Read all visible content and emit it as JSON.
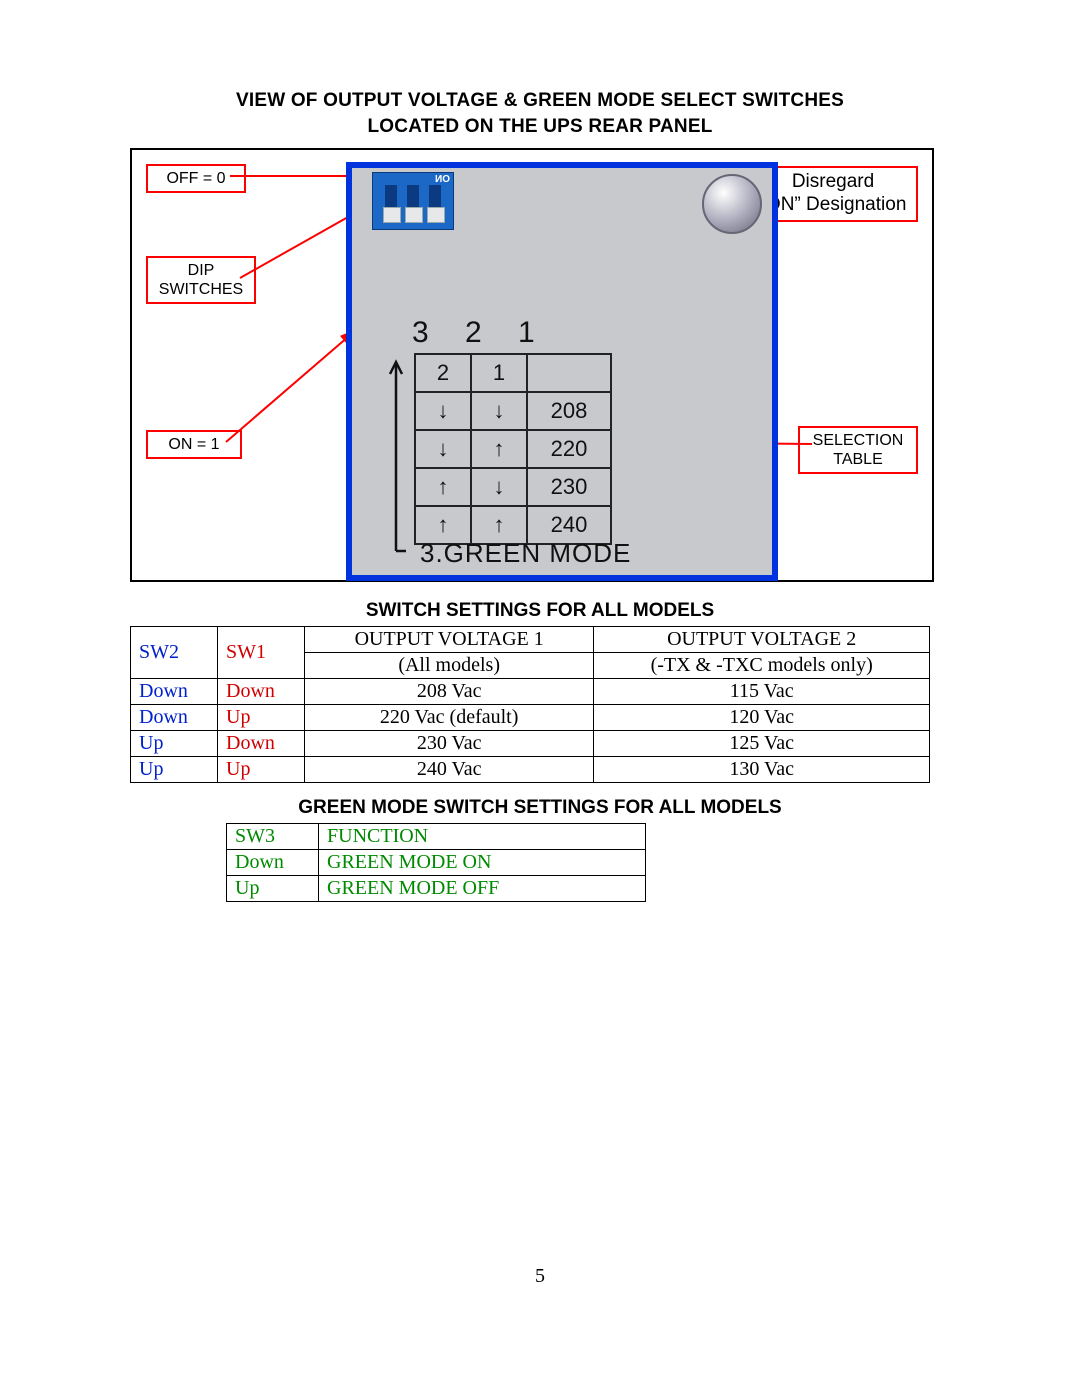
{
  "title_line1": "VIEW OF OUTPUT VOLTAGE & GREEN MODE SELECT SWITCHES",
  "title_line2": "LOCATED ON THE UPS REAR PANEL",
  "page_number": "5",
  "figure": {
    "callouts": {
      "off": "OFF = 0",
      "dip": "DIP\nSWITCHES",
      "on": "ON = 1",
      "disregard_l1": "Disregard",
      "disregard_l2": "“ON” Designation",
      "selection_l1": "SELECTION",
      "selection_l2": "TABLE"
    },
    "panel": {
      "nums": "3  2  1",
      "green_label": "3.GREEN MODE",
      "selection_rows": [
        {
          "c2": "2",
          "c1": "1",
          "val": ""
        },
        {
          "c2": "↓",
          "c1": "↓",
          "val": "208"
        },
        {
          "c2": "↓",
          "c1": "↑",
          "val": "220"
        },
        {
          "c2": "↑",
          "c1": "↓",
          "val": "230"
        },
        {
          "c2": "↑",
          "c1": "↑",
          "val": "240"
        }
      ]
    }
  },
  "switch_heading": "SWITCH SETTINGS FOR ALL MODELS",
  "switch_table": {
    "headers": {
      "sw2": "SW2",
      "sw1": "SW1",
      "ov1": "OUTPUT VOLTAGE 1",
      "ov1_sub": "(All models)",
      "ov2": "OUTPUT VOLTAGE 2",
      "ov2_sub": "(-TX & -TXC models only)"
    },
    "rows": [
      {
        "sw2": "Down",
        "sw1": "Down",
        "ov1": "208 Vac",
        "ov2": "115 Vac"
      },
      {
        "sw2": "Down",
        "sw1": "Up",
        "ov1": "220 Vac (default)",
        "ov2": "120 Vac"
      },
      {
        "sw2": "Up",
        "sw1": "Down",
        "ov1": "230 Vac",
        "ov2": "125 Vac"
      },
      {
        "sw2": "Up",
        "sw1": "Up",
        "ov1": "240 Vac",
        "ov2": "130 Vac"
      }
    ]
  },
  "green_heading": "GREEN MODE SWITCH SETTINGS FOR ALL MODELS",
  "green_table": {
    "headers": {
      "sw3": "SW3",
      "func": "FUNCTION"
    },
    "rows": [
      {
        "sw3": "Down",
        "func": "GREEN MODE ON"
      },
      {
        "sw3": "Up",
        "func": "GREEN MODE OFF"
      }
    ]
  }
}
